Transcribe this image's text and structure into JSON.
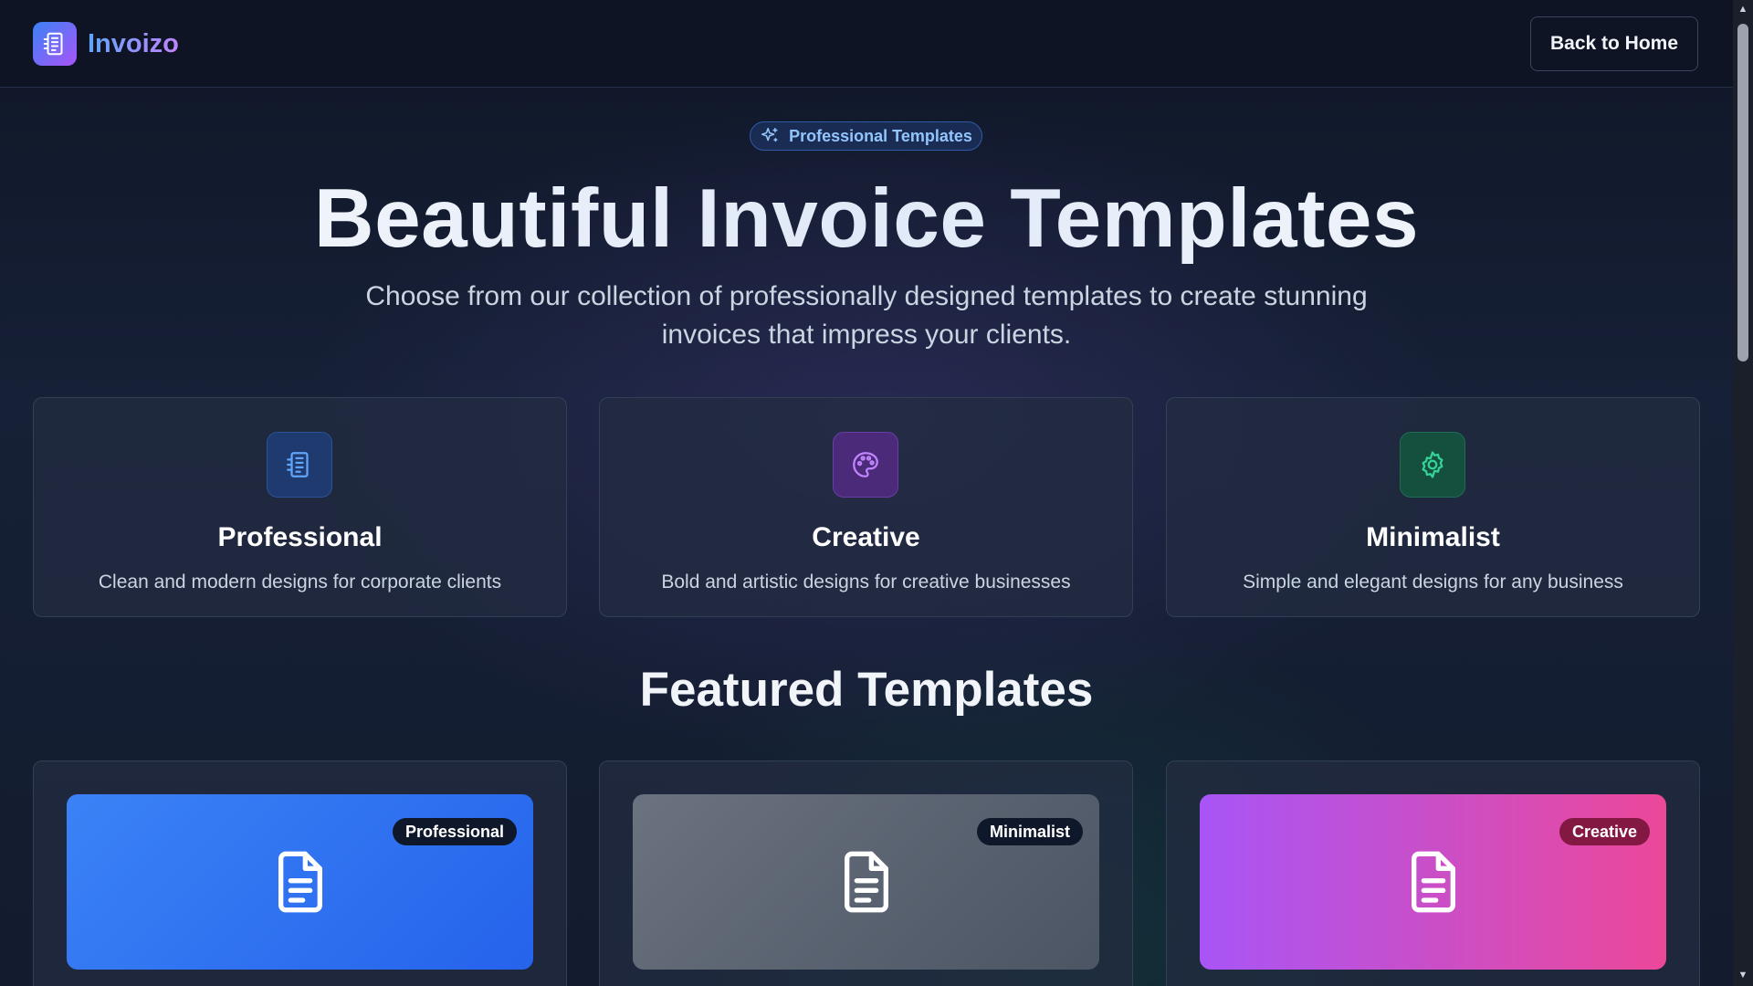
{
  "header": {
    "brand": "Invoizo",
    "back_button": "Back to Home"
  },
  "hero": {
    "pill_label": "Professional Templates",
    "title": "Beautiful Invoice Templates",
    "subtitle": "Choose from our collection of professionally designed templates to create stunning invoices that impress your clients."
  },
  "categories": [
    {
      "title": "Professional",
      "description": "Clean and modern designs for corporate clients",
      "icon": "invoice-document-icon",
      "color": "#60a5fa"
    },
    {
      "title": "Creative",
      "description": "Bold and artistic designs for creative businesses",
      "icon": "palette-icon",
      "color": "#c084fc"
    },
    {
      "title": "Minimalist",
      "description": "Simple and elegant designs for any business",
      "icon": "gear-icon",
      "color": "#34d399"
    }
  ],
  "featured": {
    "title": "Featured Templates",
    "templates": [
      {
        "badge": "Professional",
        "icon": "file-text-icon",
        "gradient": [
          "#3b82f6",
          "#2563eb"
        ]
      },
      {
        "badge": "Minimalist",
        "icon": "file-text-icon",
        "gradient": [
          "#6b7280",
          "#4b5563"
        ]
      },
      {
        "badge": "Creative",
        "icon": "file-text-icon",
        "gradient": [
          "#a855f7",
          "#ec4899"
        ]
      }
    ]
  }
}
